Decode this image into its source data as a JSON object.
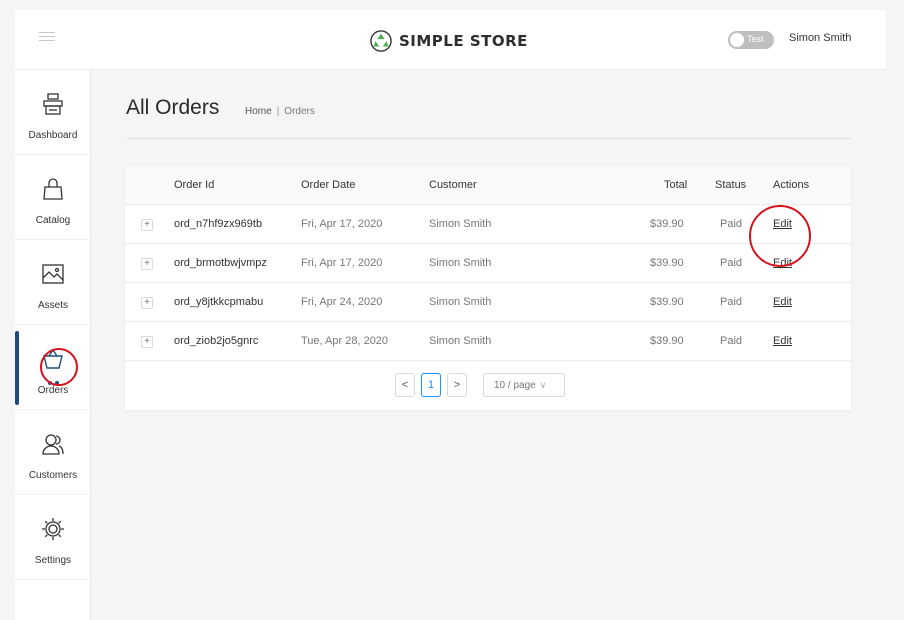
{
  "header": {
    "brand": "SIMPLE STORE",
    "env_toggle_label": "Test",
    "user_name": "Simon Smith"
  },
  "sidebar": {
    "items": [
      {
        "label": "Dashboard",
        "icon": "register-icon"
      },
      {
        "label": "Catalog",
        "icon": "shopping-bag-icon"
      },
      {
        "label": "Assets",
        "icon": "image-icon"
      },
      {
        "label": "Orders",
        "icon": "basket-icon",
        "active": true
      },
      {
        "label": "Customers",
        "icon": "people-icon"
      },
      {
        "label": "Settings",
        "icon": "gear-icon"
      }
    ]
  },
  "page": {
    "title": "All Orders",
    "breadcrumb": {
      "home": "Home",
      "separator": "|",
      "current": "Orders"
    }
  },
  "table": {
    "columns": {
      "order_id": "Order Id",
      "order_date": "Order Date",
      "customer": "Customer",
      "total": "Total",
      "status": "Status",
      "actions": "Actions"
    },
    "rows": [
      {
        "expand": "+",
        "order_id": "ord_n7hf9zx969tb",
        "order_date": "Fri, Apr 17, 2020",
        "customer": "Simon Smith",
        "total": "$39.90",
        "status": "Paid",
        "action": "Edit"
      },
      {
        "expand": "+",
        "order_id": "ord_brmotbwjvmpz",
        "order_date": "Fri, Apr 17, 2020",
        "customer": "Simon Smith",
        "total": "$39.90",
        "status": "Paid",
        "action": "Edit"
      },
      {
        "expand": "+",
        "order_id": "ord_y8jtkkcpmabu",
        "order_date": "Fri, Apr 24, 2020",
        "customer": "Simon Smith",
        "total": "$39.90",
        "status": "Paid",
        "action": "Edit"
      },
      {
        "expand": "+",
        "order_id": "ord_ziob2jo5gnrc",
        "order_date": "Tue, Apr 28, 2020",
        "customer": "Simon Smith",
        "total": "$39.90",
        "status": "Paid",
        "action": "Edit"
      }
    ]
  },
  "pagination": {
    "prev": "<",
    "current_page": "1",
    "next": ">",
    "page_size": "10 / page"
  },
  "colors": {
    "active_nav": "#1f4e79",
    "annotation": "#d4121e",
    "pager_active": "#1890ff"
  }
}
